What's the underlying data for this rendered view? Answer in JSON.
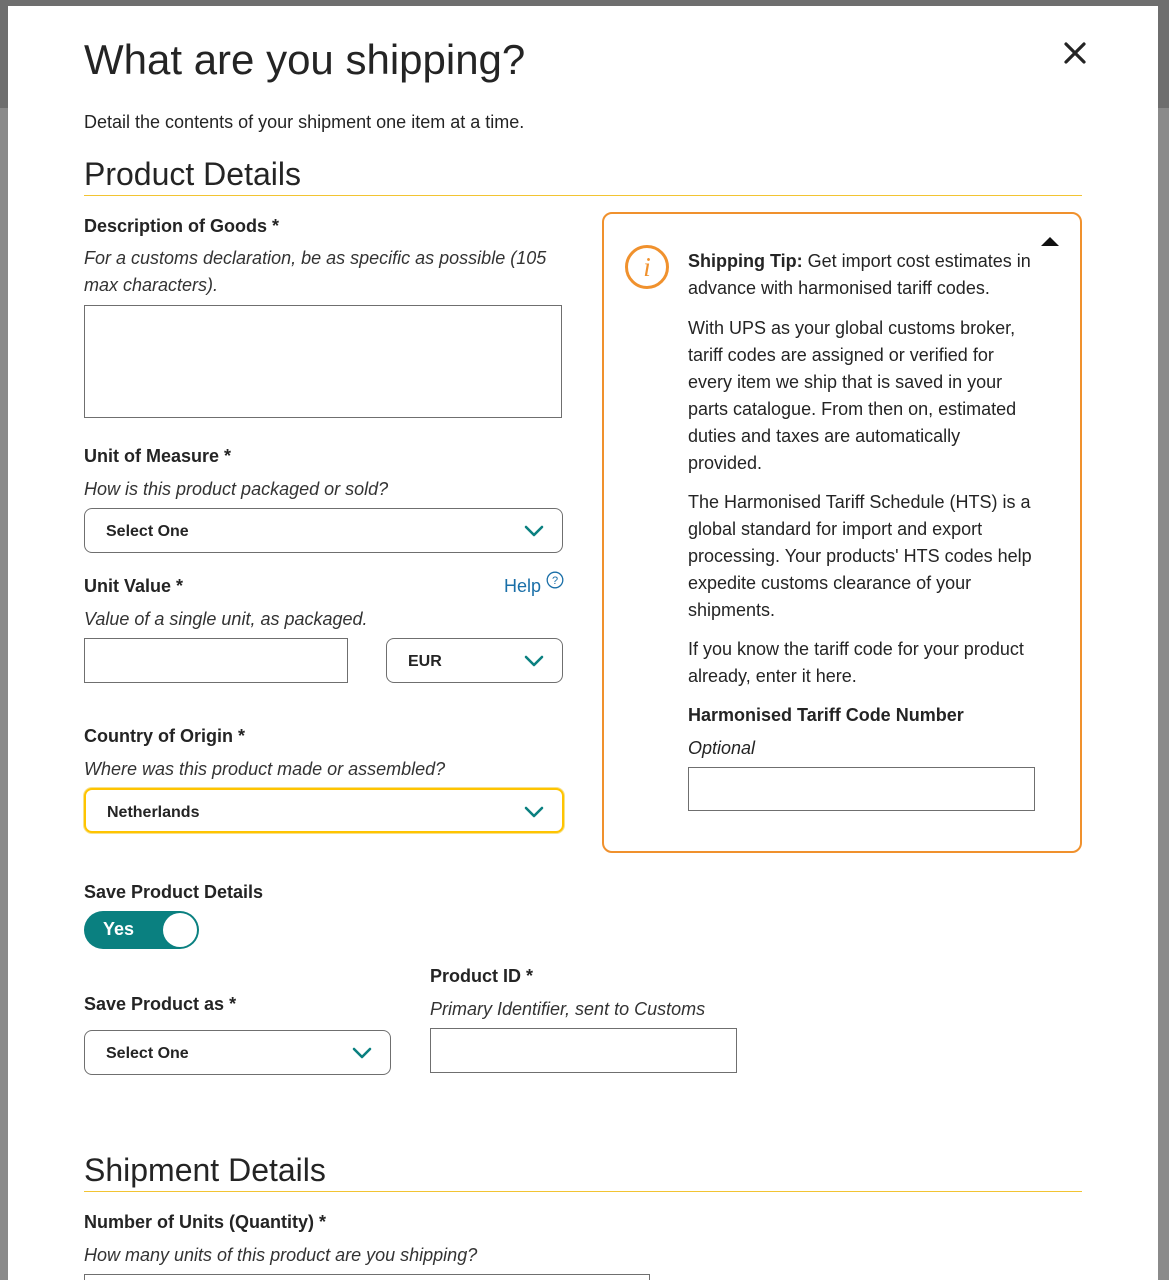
{
  "modal": {
    "title": "What are you shipping?",
    "intro": "Detail the contents of your shipment one item at a time."
  },
  "product_details": {
    "heading": "Product Details",
    "description": {
      "label": "Description of Goods *",
      "hint": "For a customs declaration, be as specific as possible (105 max characters).",
      "value": ""
    },
    "unit_of_measure": {
      "label": "Unit of Measure *",
      "hint": "How is this product packaged or sold?",
      "selected": "Select One"
    },
    "unit_value": {
      "label": "Unit Value *",
      "help": "Help",
      "hint": "Value of a single unit, as packaged.",
      "value": "",
      "currency": "EUR"
    },
    "country_of_origin": {
      "label": "Country of Origin *",
      "hint": "Where was this product made or assembled?",
      "selected": "Netherlands"
    },
    "save_product_details": {
      "label": "Save Product Details",
      "toggle_label": "Yes",
      "enabled": true
    },
    "save_product_as": {
      "label": "Save Product as *",
      "selected": "Select One"
    },
    "product_id": {
      "label": "Product ID *",
      "hint": "Primary Identifier, sent to Customs",
      "value": ""
    }
  },
  "shipping_tip": {
    "lead_bold": "Shipping Tip:",
    "lead_text": " Get import cost estimates in advance with harmonised tariff codes.",
    "para1": "With UPS as your global customs broker, tariff codes are assigned or verified for every item we ship that is saved in your parts catalogue. From then on, estimated duties and taxes are automatically provided.",
    "para2": "The Harmonised Tariff Schedule (HTS) is a global standard for import and export processing. Your products' HTS codes help expedite customs clearance of your shipments.",
    "para3": "If you know the tariff code for your product already, enter it here.",
    "tariff_label": "Harmonised Tariff Code Number",
    "tariff_hint": "Optional",
    "tariff_value": "",
    "colors": {
      "border": "#f0912d"
    }
  },
  "shipment_details": {
    "heading": "Shipment Details",
    "quantity": {
      "label": "Number of Units (Quantity) *",
      "hint": "How many units of this product are you shipping?"
    }
  },
  "icons": [
    "close-icon",
    "chevron-down-icon",
    "help-circle-icon",
    "info-icon",
    "collapse-triangle-icon"
  ],
  "colors": {
    "accent": "#0a8080",
    "rule": "#f2c433",
    "focus": "#ffc400",
    "link": "#1a6fa8"
  }
}
